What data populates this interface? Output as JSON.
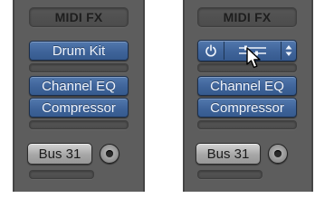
{
  "left_strip": {
    "header": "MIDI FX",
    "instrument_label": "Drum Kit",
    "effects": [
      "Channel EQ",
      "Compressor"
    ],
    "output_label": "Bus 31"
  },
  "right_strip": {
    "header": "MIDI FX",
    "effects": [
      "Channel EQ",
      "Compressor"
    ],
    "output_label": "Bus 31",
    "instrument_controls": {
      "power_icon": "power-icon",
      "settings_icon": "slider-settings-icon",
      "menu_icon": "up-down-arrows-icon"
    }
  },
  "colors": {
    "strip": "#5d5d5d",
    "plugin_blue": "#4470a6",
    "button_grey": "#b0b0b0"
  }
}
